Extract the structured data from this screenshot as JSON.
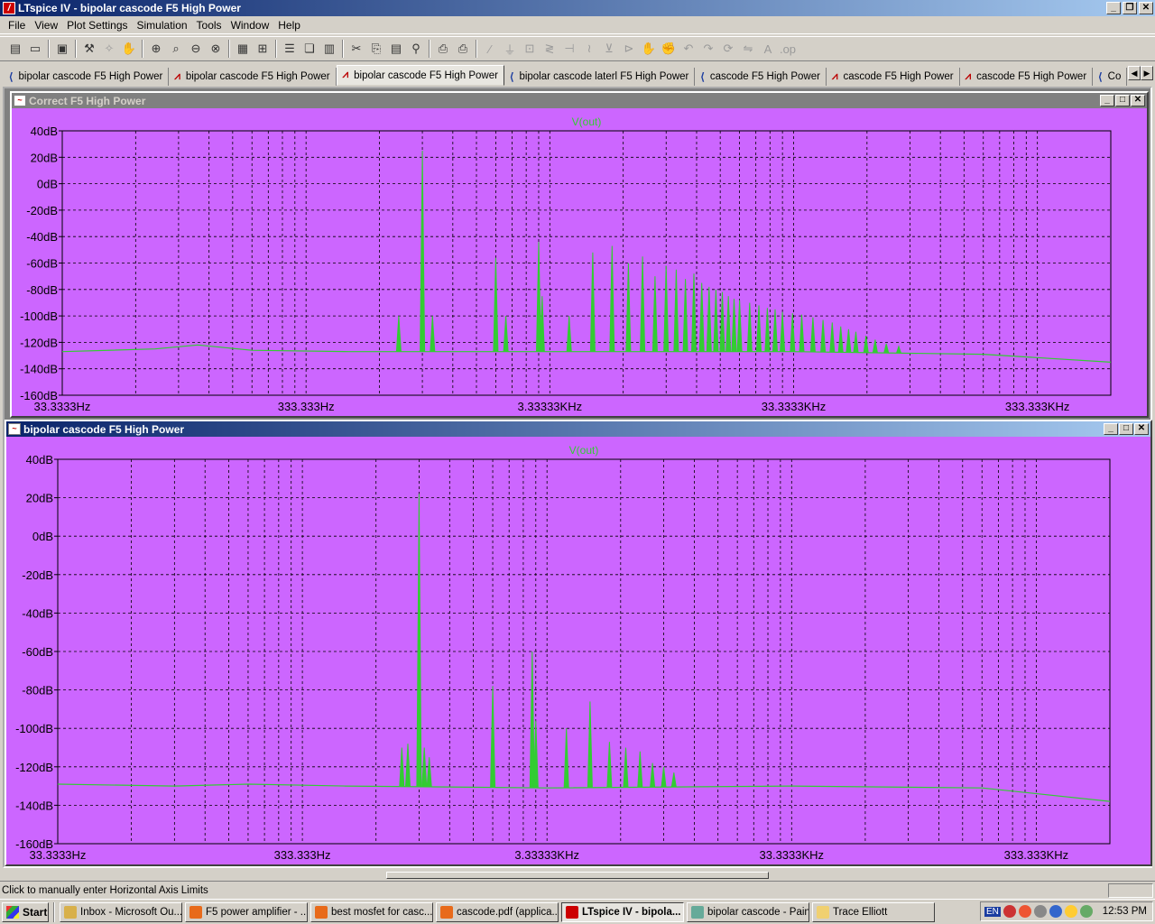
{
  "window": {
    "title": "LTspice IV - bipolar cascode F5 High Power",
    "app_icon": "ltspice-icon"
  },
  "menu": [
    "File",
    "View",
    "Plot Settings",
    "Simulation",
    "Tools",
    "Window",
    "Help"
  ],
  "toolbar": {
    "icons": [
      "new-schematic-icon",
      "open-icon",
      "save-icon",
      "control-panel-icon",
      "run-icon",
      "halt-icon",
      "zoom-in-icon",
      "zoom-area-icon",
      "zoom-out-icon",
      "zoom-fit-icon",
      "autorange-icon",
      "grid-icon",
      "tile-horizontal-icon",
      "cascade-icon",
      "tile-vertical-icon",
      "cut-icon",
      "copy-icon",
      "paste-icon",
      "find-icon",
      "print-setup-icon",
      "print-icon",
      "wire-icon",
      "ground-icon",
      "label-icon",
      "resistor-icon",
      "capacitor-icon",
      "inductor-icon",
      "diode-icon",
      "component-icon",
      "move-icon",
      "drag-icon",
      "undo-icon",
      "redo-icon",
      "rotate-icon",
      "mirror-icon",
      "text-icon",
      "spice-directive-icon"
    ]
  },
  "tabs": [
    {
      "label": "bipolar cascode F5 High Power",
      "icon": "schematic-icon",
      "active": false
    },
    {
      "label": "bipolar cascode F5 High Power",
      "icon": "waveform-icon",
      "active": false
    },
    {
      "label": "bipolar cascode F5 High Power",
      "icon": "waveform-icon",
      "active": true
    },
    {
      "label": "bipolar cascode laterl F5 High Power",
      "icon": "schematic-icon",
      "active": false
    },
    {
      "label": "cascode F5 High Power",
      "icon": "schematic-icon",
      "active": false
    },
    {
      "label": "cascode F5 High Power",
      "icon": "waveform-icon",
      "active": false
    },
    {
      "label": "cascode F5 High Power",
      "icon": "waveform-icon",
      "active": false
    },
    {
      "label": "Co",
      "icon": "schematic-icon",
      "active": false
    }
  ],
  "panes": [
    {
      "title": "Correct F5 High Power",
      "active": false,
      "trace_label": "V(out)"
    },
    {
      "title": "bipolar cascode F5 High Power",
      "active": true,
      "trace_label": "V(out)"
    }
  ],
  "chart_data": [
    {
      "type": "line",
      "title": "",
      "trace": "V(out)",
      "x_scale": "log",
      "xlim": [
        33.3333,
        666666
      ],
      "x_ticks": [
        "33.3333Hz",
        "333.333Hz",
        "3.33333KHz",
        "33.3333KHz",
        "333.333KHz"
      ],
      "ylim": [
        -160,
        40
      ],
      "y_ticks": [
        "40dB",
        "20dB",
        "0dB",
        "-20dB",
        "-40dB",
        "-60dB",
        "-80dB",
        "-100dB",
        "-120dB",
        "-140dB",
        "-160dB"
      ],
      "grid": true,
      "noise_floor": [
        [
          33.3333,
          -127
        ],
        [
          80,
          -125
        ],
        [
          120,
          -122
        ],
        [
          200,
          -126
        ],
        [
          500,
          -127
        ],
        [
          3333.33,
          -127
        ],
        [
          33333.3,
          -127
        ],
        [
          200000,
          -129
        ],
        [
          666666,
          -135
        ]
      ],
      "peaks": [
        [
          800,
          -100
        ],
        [
          1000,
          25
        ],
        [
          1100,
          -100
        ],
        [
          2000,
          -56
        ],
        [
          2200,
          -100
        ],
        [
          3000,
          -44
        ],
        [
          3100,
          -85
        ],
        [
          4000,
          -100
        ],
        [
          5000,
          -52
        ],
        [
          6000,
          -47
        ],
        [
          7000,
          -60
        ],
        [
          8000,
          -55
        ],
        [
          9000,
          -70
        ],
        [
          10000,
          -62
        ],
        [
          11000,
          -65
        ],
        [
          12000,
          -72
        ],
        [
          13000,
          -68
        ],
        [
          14000,
          -75
        ],
        [
          15000,
          -78
        ],
        [
          16000,
          -80
        ],
        [
          17000,
          -82
        ],
        [
          18000,
          -85
        ],
        [
          19000,
          -87
        ],
        [
          20000,
          -88
        ],
        [
          22000,
          -90
        ],
        [
          24000,
          -92
        ],
        [
          26000,
          -94
        ],
        [
          28000,
          -95
        ],
        [
          30000,
          -97
        ],
        [
          33000,
          -98
        ],
        [
          36000,
          -99
        ],
        [
          40000,
          -101
        ],
        [
          44000,
          -103
        ],
        [
          48000,
          -105
        ],
        [
          52000,
          -108
        ],
        [
          56000,
          -110
        ],
        [
          60000,
          -112
        ],
        [
          66000,
          -115
        ],
        [
          72000,
          -118
        ],
        [
          80000,
          -121
        ],
        [
          90000,
          -123
        ]
      ]
    },
    {
      "type": "line",
      "title": "",
      "trace": "V(out)",
      "x_scale": "log",
      "xlim": [
        33.3333,
        666666
      ],
      "x_ticks": [
        "33.3333Hz",
        "333.333Hz",
        "3.33333KHz",
        "33.3333KHz",
        "333.333KHz"
      ],
      "ylim": [
        -160,
        40
      ],
      "y_ticks": [
        "40dB",
        "20dB",
        "0dB",
        "-20dB",
        "-40dB",
        "-60dB",
        "-80dB",
        "-100dB",
        "-120dB",
        "-140dB",
        "-160dB"
      ],
      "grid": true,
      "noise_floor": [
        [
          33.3333,
          -129
        ],
        [
          100,
          -130
        ],
        [
          200,
          -129
        ],
        [
          500,
          -130
        ],
        [
          3333.33,
          -131
        ],
        [
          33333.3,
          -130
        ],
        [
          200000,
          -131
        ],
        [
          666666,
          -138
        ]
      ],
      "peaks": [
        [
          850,
          -110
        ],
        [
          900,
          -108
        ],
        [
          1000,
          22
        ],
        [
          1050,
          -110
        ],
        [
          1100,
          -115
        ],
        [
          2000,
          -78
        ],
        [
          2900,
          -60
        ],
        [
          3000,
          -96
        ],
        [
          4000,
          -100
        ],
        [
          5000,
          -86
        ],
        [
          6000,
          -107
        ],
        [
          7000,
          -110
        ],
        [
          8000,
          -112
        ],
        [
          9000,
          -118
        ],
        [
          10000,
          -120
        ],
        [
          11000,
          -123
        ]
      ]
    }
  ],
  "status": {
    "text": "Click to manually enter Horizontal Axis Limits"
  },
  "taskbar": {
    "start_label": "Start",
    "tasks": [
      {
        "label": "Inbox - Microsoft Ou...",
        "icon": "outlook-icon",
        "active": false
      },
      {
        "label": "F5 power amplifier - ...",
        "icon": "firefox-icon",
        "active": false
      },
      {
        "label": "best mosfet for casc...",
        "icon": "firefox-icon",
        "active": false
      },
      {
        "label": "cascode.pdf (applica...",
        "icon": "firefox-icon",
        "active": false
      },
      {
        "label": "LTspice IV - bipola...",
        "icon": "ltspice-icon",
        "active": true
      },
      {
        "label": "bipolar cascode - Paint",
        "icon": "paint-icon",
        "active": false
      },
      {
        "label": "Trace Elliott",
        "icon": "folder-icon",
        "active": false
      }
    ],
    "tray_lang": "EN",
    "clock": "12:53 PM"
  },
  "colors": {
    "plot_bg": "#cc66ff",
    "trace": "#33cc33",
    "grid": "#000000"
  }
}
